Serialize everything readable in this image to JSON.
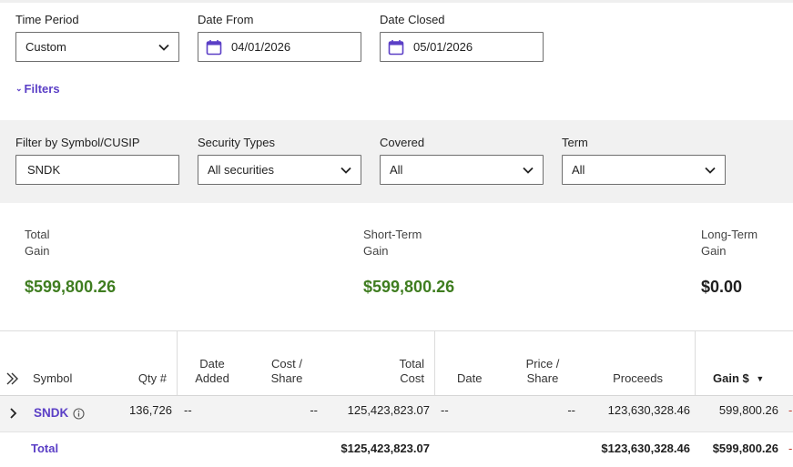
{
  "criteria": {
    "time_period": {
      "label": "Time Period",
      "value": "Custom"
    },
    "date_from": {
      "label": "Date From",
      "value": "04/01/2026"
    },
    "date_closed": {
      "label": "Date Closed",
      "value": "05/01/2026"
    },
    "filters_toggle": "Filters"
  },
  "filters": {
    "symbol": {
      "label": "Filter by Symbol/CUSIP",
      "value": "SNDK"
    },
    "security_types": {
      "label": "Security Types",
      "value": "All securities"
    },
    "covered": {
      "label": "Covered",
      "value": "All"
    },
    "term": {
      "label": "Term",
      "value": "All"
    }
  },
  "summary": {
    "total": {
      "label_line1": "Total",
      "label_line2": "Gain",
      "value": "$599,800.26"
    },
    "short_term": {
      "label_line1": "Short-Term",
      "label_line2": "Gain",
      "value": "$599,800.26"
    },
    "long_term": {
      "label_line1": "Long-Term",
      "label_line2": "Gain",
      "value": "$0.00"
    }
  },
  "table": {
    "headers": {
      "symbol": "Symbol",
      "qty": "Qty #",
      "date_added_1": "Date",
      "date_added_2": "Added",
      "cost_share_1": "Cost /",
      "cost_share_2": "Share",
      "total_cost_1": "Total",
      "total_cost_2": "Cost",
      "date": "Date",
      "price_share_1": "Price /",
      "price_share_2": "Share",
      "proceeds": "Proceeds",
      "gain": "Gain $"
    },
    "rows": [
      {
        "symbol": "SNDK",
        "qty": "136,726",
        "date_added": "--",
        "cost_share": "--",
        "total_cost": "125,423,823.07",
        "date": "--",
        "price_share": "--",
        "proceeds": "123,630,328.46",
        "gain": "599,800.26",
        "next_cell": "-"
      }
    ],
    "total": {
      "label": "Total",
      "total_cost": "$125,423,823.07",
      "proceeds": "$123,630,328.46",
      "gain": "$599,800.26",
      "next_cell": "-"
    }
  },
  "colors": {
    "accent": "#5b3fc6",
    "gain": "#3f7d20",
    "negative": "#c0392b"
  }
}
